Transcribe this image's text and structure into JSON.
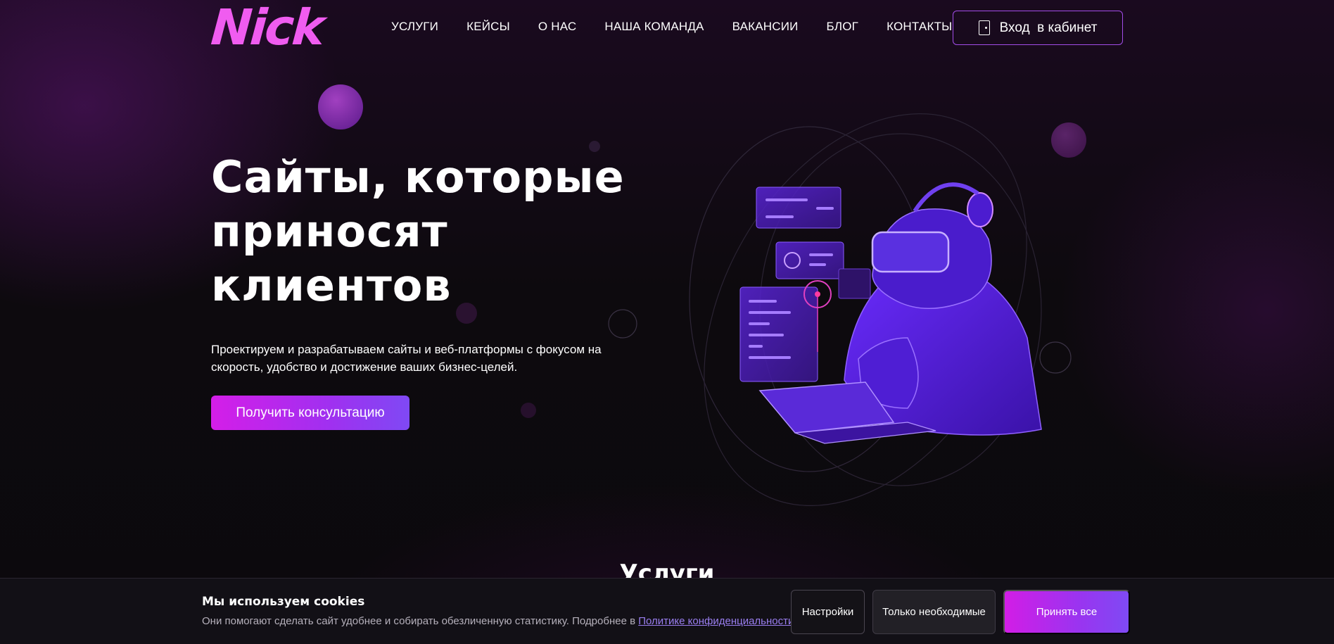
{
  "brand": {
    "logo_text": "Nick",
    "accent": "#e040fb",
    "accent_2": "#7f49f4"
  },
  "nav": {
    "items": [
      "УСЛУГИ",
      "КЕЙСЫ",
      "О НАС",
      "НАША КОМАНДА",
      "ВАКАНСИИ",
      "БЛОГ",
      "КОНТАКТЫ"
    ],
    "login_label": "Вход  в кабинет",
    "login_icon": "door-icon"
  },
  "hero": {
    "title_lines": [
      "Сайты, которые",
      "приносят",
      "клиентов"
    ],
    "subtitle_lines": [
      "Проектируем и разрабатываем сайты и веб-платформы с фокусом на",
      "скорость, удобство и достижение ваших бизнес-целей."
    ],
    "cta_label": "Получить консультацию",
    "illustration": "vr-developer-illustration"
  },
  "next_section": {
    "title": "Услуги"
  },
  "cookie": {
    "title": "Мы используем cookies",
    "text": "Они помогают сделать сайт удобнее и собирать обезличенную статистику. Подробнее в ",
    "link": "Политике конфиденциальности",
    "text_end": ".",
    "settings_label": "Настройки",
    "necessary_label": "Только необходимые",
    "accept_label": "Принять все"
  }
}
